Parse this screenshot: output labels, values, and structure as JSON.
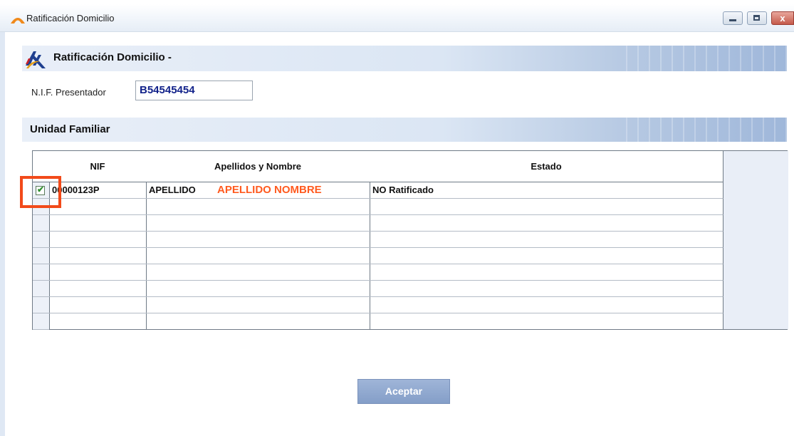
{
  "window": {
    "title": "Ratificación Domicilio",
    "controls": {
      "minimize": "minimize",
      "maximize": "maximize",
      "close": "x"
    }
  },
  "header": {
    "title": "Ratificación Domicilio -"
  },
  "presenter": {
    "label": "N.I.F. Presentador",
    "value": "B54545454"
  },
  "family_section": {
    "title": "Unidad Familiar"
  },
  "table": {
    "columns": [
      "NIF",
      "Apellidos y Nombre",
      "Estado"
    ],
    "rows": [
      {
        "checked": true,
        "nif": "00000123P",
        "name": "APELLIDO",
        "name_annotation": "APELLIDO NOMBRE",
        "status": "NO Ratificado"
      }
    ],
    "empty_rows": 8
  },
  "actions": {
    "accept_label": "Aceptar"
  },
  "colors": {
    "highlight": "#f24a1a",
    "annotation_text": "#ff5a1f",
    "nif_value": "#12228a"
  },
  "icons": [
    "app-logo-icon",
    "agencia-tributaria-logo-icon",
    "minimize-icon",
    "maximize-icon",
    "close-icon",
    "checkbox-checked-icon"
  ]
}
